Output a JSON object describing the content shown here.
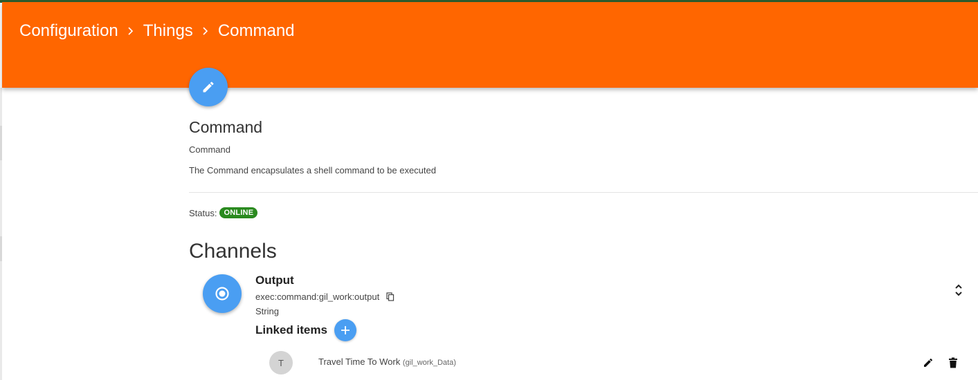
{
  "breadcrumb": {
    "items": [
      "Configuration",
      "Things",
      "Command"
    ],
    "separator": "›"
  },
  "thing": {
    "title": "Command",
    "label": "Command",
    "description": "The Command encapsulates a shell command to be executed",
    "status_label": "Status:",
    "status_value": "ONLINE"
  },
  "channels": {
    "title": "Channels",
    "items": [
      {
        "name": "Output",
        "uid": "exec:command:gil_work:output",
        "type": "String",
        "linked_label": "Linked items",
        "linked_items": [
          {
            "initial": "T",
            "label": "Travel Time To Work",
            "name": "(gil_work_Data)"
          }
        ]
      }
    ]
  },
  "icons": {
    "edit_fab": "pencil-icon",
    "channel": "radio-target-icon",
    "copy": "copy-icon",
    "add": "plus-icon",
    "collapse": "collapse-chevrons-icon",
    "item_edit": "pencil-icon",
    "item_delete": "trash-icon"
  },
  "colors": {
    "header": "#ff6600",
    "accent": "#4a9ef2",
    "status_online": "#2a8a1f"
  }
}
